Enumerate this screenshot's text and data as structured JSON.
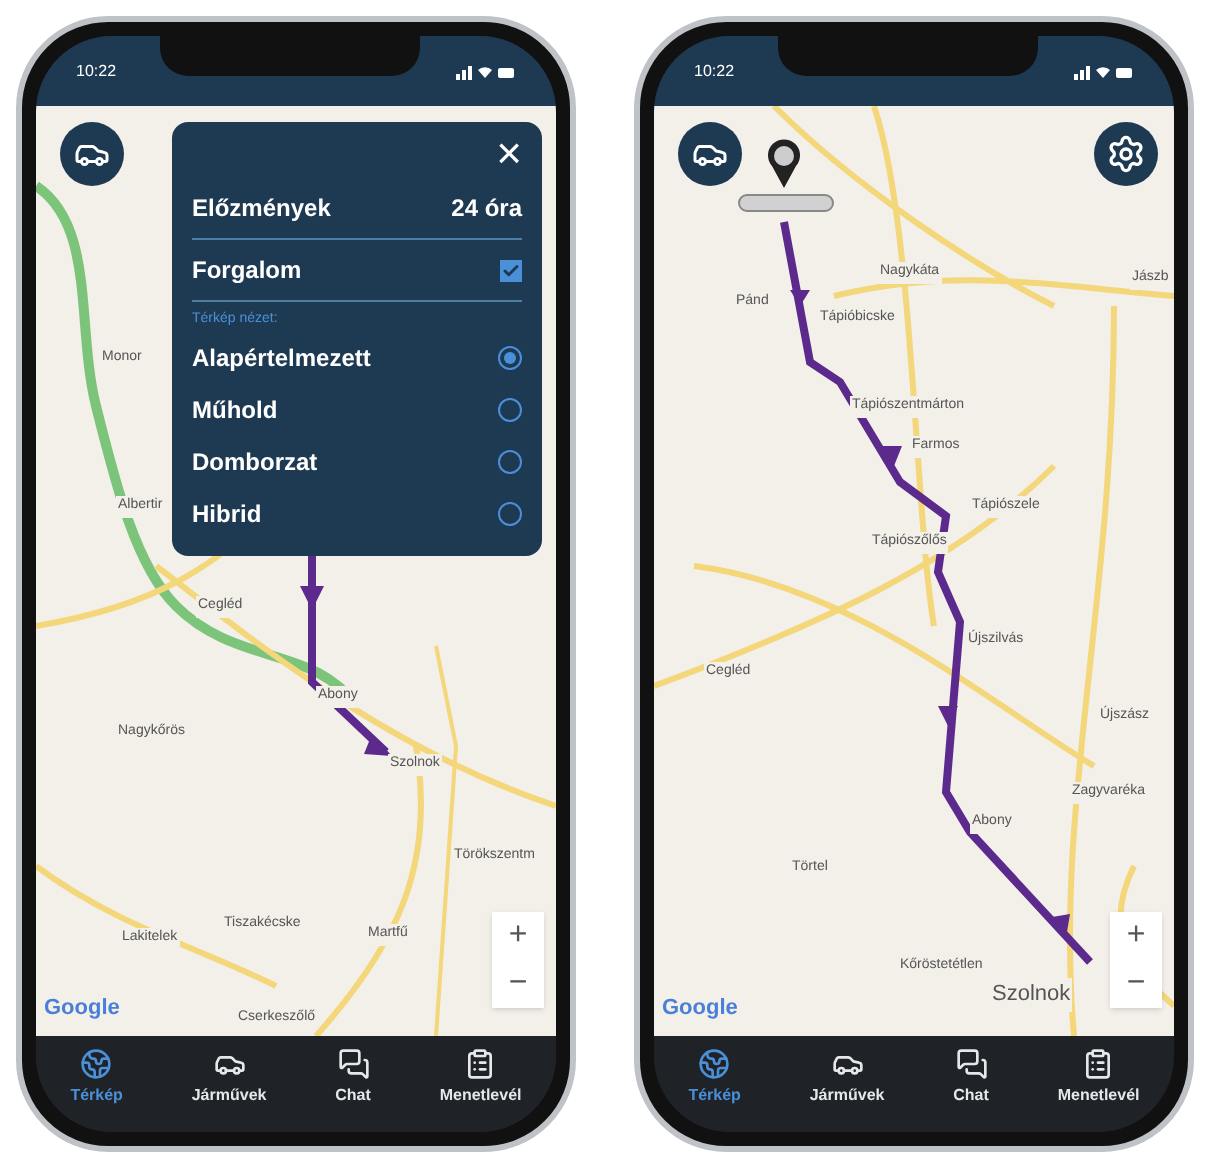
{
  "phones": [
    {
      "status_time": "10:22",
      "map": {
        "kind": "overview",
        "labels": [
          "Monor",
          "Albertir",
          "Cegléd",
          "Nagykőrös",
          "Abony",
          "Szolnok",
          "Törökszentm",
          "Tiszakécske",
          "Martfű",
          "Lakitelek",
          "Cserkeszőlő"
        ],
        "attribution": "Google"
      },
      "top_buttons": [
        {
          "kind": "vehicles"
        }
      ],
      "settings_panel": {
        "close": "×",
        "history": {
          "label": "Előzmények",
          "value": "24 óra"
        },
        "traffic": {
          "label": "Forgalom",
          "checked": true
        },
        "view_caption": "Térkép nézet:",
        "views": [
          {
            "label": "Alapértelmezett",
            "selected": true
          },
          {
            "label": "Műhold",
            "selected": false
          },
          {
            "label": "Domborzat",
            "selected": false
          },
          {
            "label": "Hibrid",
            "selected": false
          }
        ]
      },
      "zoom": {
        "plus": "+",
        "minus": "−"
      },
      "nav": [
        {
          "kind": "map",
          "label": "Térkép",
          "selected": true
        },
        {
          "kind": "vehicles",
          "label": "Járművek",
          "selected": false
        },
        {
          "kind": "chat",
          "label": "Chat",
          "selected": false
        },
        {
          "kind": "log",
          "label": "Menetlevél",
          "selected": false
        }
      ]
    },
    {
      "status_time": "10:22",
      "map": {
        "kind": "detail",
        "labels": [
          "Pánd",
          "Tápióbicske",
          "Nagykáta",
          "Jászb",
          "Tápiószentmárton",
          "Farmos",
          "Tápiószele",
          "Tápiószőlős",
          "Újszilvás",
          "Cegléd",
          "Újszász",
          "Zagyvaréka",
          "Abony",
          "Törtel",
          "Kőröstetétlen",
          "Szolnok"
        ],
        "attribution": "Google"
      },
      "top_buttons": [
        {
          "kind": "vehicles"
        },
        {
          "kind": "settings"
        }
      ],
      "markers": [
        {
          "kind": "vehicle-pin"
        }
      ],
      "zoom": {
        "plus": "+",
        "minus": "−"
      },
      "nav": [
        {
          "kind": "map",
          "label": "Térkép",
          "selected": true
        },
        {
          "kind": "vehicles",
          "label": "Járművek",
          "selected": false
        },
        {
          "kind": "chat",
          "label": "Chat",
          "selected": false
        },
        {
          "kind": "log",
          "label": "Menetlevél",
          "selected": false
        }
      ]
    }
  ]
}
